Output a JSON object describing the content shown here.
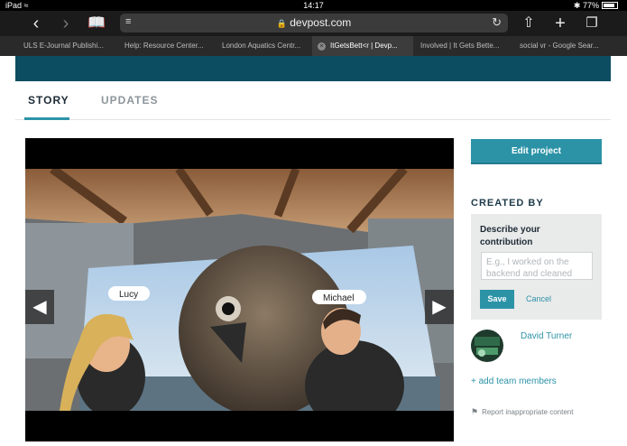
{
  "status_bar": {
    "device": "iPad",
    "time": "14:17",
    "battery": "77%"
  },
  "browser": {
    "url": "devpost.com",
    "tabs": [
      {
        "label": "ULS E-Journal Publishi...",
        "active": false
      },
      {
        "label": "Help: Resource Center...",
        "active": false
      },
      {
        "label": "London Aquatics Centr...",
        "active": false
      },
      {
        "label": "ItGetsBett<r | Devp...",
        "active": true
      },
      {
        "label": "Involved | It Gets Bette...",
        "active": false
      },
      {
        "label": "social vr - Google Sear...",
        "active": false
      }
    ]
  },
  "subnav": {
    "story": "STORY",
    "updates": "UPDATES"
  },
  "video": {
    "avatar_labels": [
      "Lucy",
      "Michael"
    ]
  },
  "sidebar": {
    "edit_project": "Edit project",
    "created_by": "CREATED BY",
    "contribution": {
      "title": "Describe your contribution",
      "placeholder": "E.g., I worked on the backend and cleaned",
      "save": "Save",
      "cancel": "Cancel"
    },
    "member_name": "David Turner",
    "add_members": "+ add team members",
    "report": "Report inappropriate content"
  },
  "colors": {
    "accent": "#2c93a7",
    "banner": "#0d4d62"
  }
}
